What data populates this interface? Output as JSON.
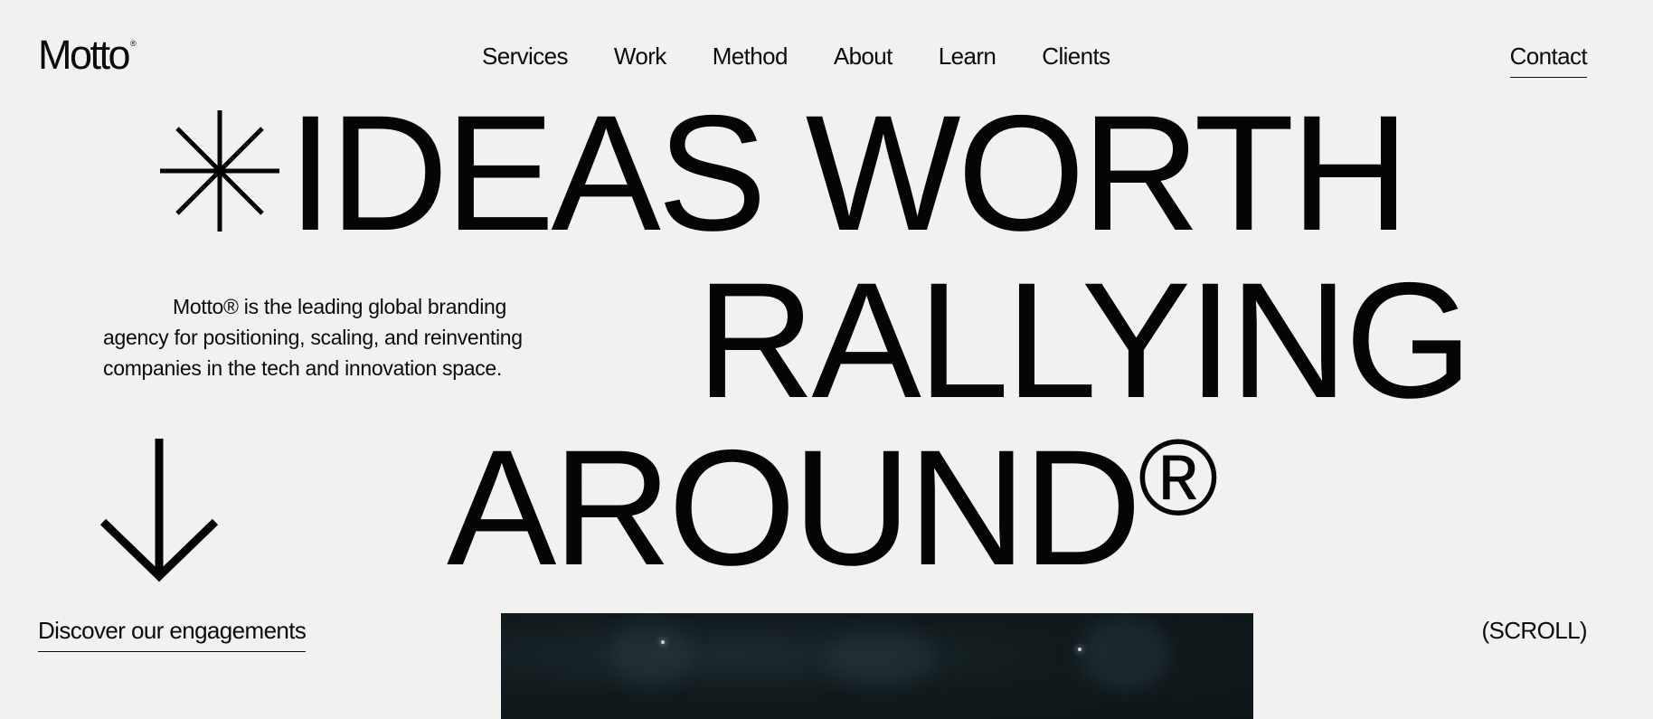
{
  "brand": {
    "name": "Motto",
    "registered": "®"
  },
  "nav": {
    "items": [
      {
        "label": "Services"
      },
      {
        "label": "Work"
      },
      {
        "label": "Method"
      },
      {
        "label": "About"
      },
      {
        "label": "Learn"
      },
      {
        "label": "Clients"
      }
    ],
    "contact_label": "Contact"
  },
  "hero": {
    "line1": "IDEAS WORTH",
    "line2": "RALLYING",
    "line3": "AROUND",
    "line3_mark": "®",
    "intro": "Motto® is the leading global branding agency for positioning, scaling, and reinventing companies in the tech and innovation space.",
    "icons": [
      "asterisk-icon",
      "arrow-down-icon"
    ]
  },
  "footer_row": {
    "discover_label": "Discover our engagements",
    "scroll_label": "(SCROLL)"
  },
  "colors": {
    "background": "#f1f1f1",
    "text": "#0b0b0b",
    "media_dark": "#111b1e"
  }
}
